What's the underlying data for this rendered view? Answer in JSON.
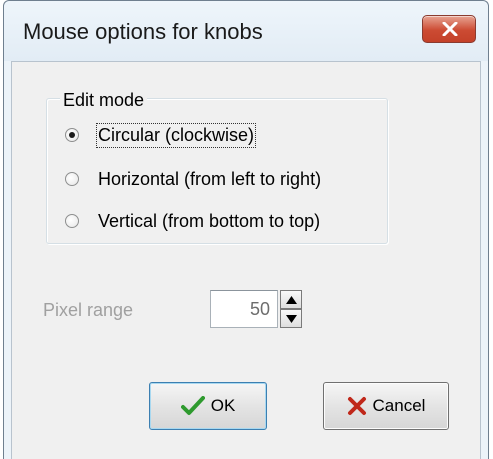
{
  "window": {
    "title": "Mouse options for knobs",
    "close_icon": "close-icon"
  },
  "edit_mode": {
    "group_label": "Edit mode",
    "options": [
      {
        "label": "Circular (clockwise)",
        "checked": true
      },
      {
        "label": "Horizontal (from left to right)",
        "checked": false
      },
      {
        "label": "Vertical (from bottom to top)",
        "checked": false
      }
    ]
  },
  "pixel_range": {
    "label": "Pixel range",
    "value": "50"
  },
  "buttons": {
    "ok_label": "OK",
    "ok_icon": "checkmark-icon",
    "cancel_label": "Cancel",
    "cancel_icon": "x-icon"
  },
  "colors": {
    "checkmark": "#2e9a2e",
    "cancel_x": "#c0281a",
    "close_button": "#cc4b33"
  }
}
